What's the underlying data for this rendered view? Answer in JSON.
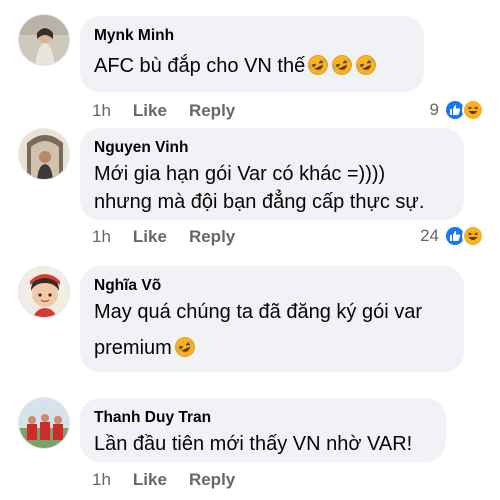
{
  "comments": [
    {
      "name": "Mynk Minh",
      "text": "AFC bù đắp cho VN thế",
      "emojis": [
        "rolling-laughing-emoji",
        "rolling-laughing-emoji",
        "rolling-laughing-emoji"
      ],
      "time": "1h",
      "like_label": "Like",
      "reply_label": "Reply",
      "reaction_count": "9",
      "reactions": [
        "like-reaction-icon",
        "haha-reaction-icon"
      ]
    },
    {
      "name": "Nguyen Vinh",
      "text_line1": "Mới gia hạn gói Var có khác =))))",
      "text_line2": "nhưng mà đội bạn đẳng cấp thực sự.",
      "time": "1h",
      "like_label": "Like",
      "reply_label": "Reply",
      "reaction_count": "24",
      "reactions": [
        "like-reaction-icon",
        "haha-reaction-icon"
      ]
    },
    {
      "name": "Nghĩa Võ",
      "text_line1": "May quá chúng ta đã đăng ký gói var",
      "text_line2": "premium",
      "emojis": [
        "rolling-laughing-emoji"
      ]
    },
    {
      "name": "Thanh Duy Tran",
      "text": "Lần đầu tiên mới thấy VN nhờ VAR!",
      "time": "1h",
      "like_label": "Like",
      "reply_label": "Reply"
    }
  ],
  "colors": {
    "bubble": "#f0f2f5",
    "meta_text": "#65676b",
    "like_blue": "#1877f2",
    "haha_yellow": "#f7b125"
  }
}
